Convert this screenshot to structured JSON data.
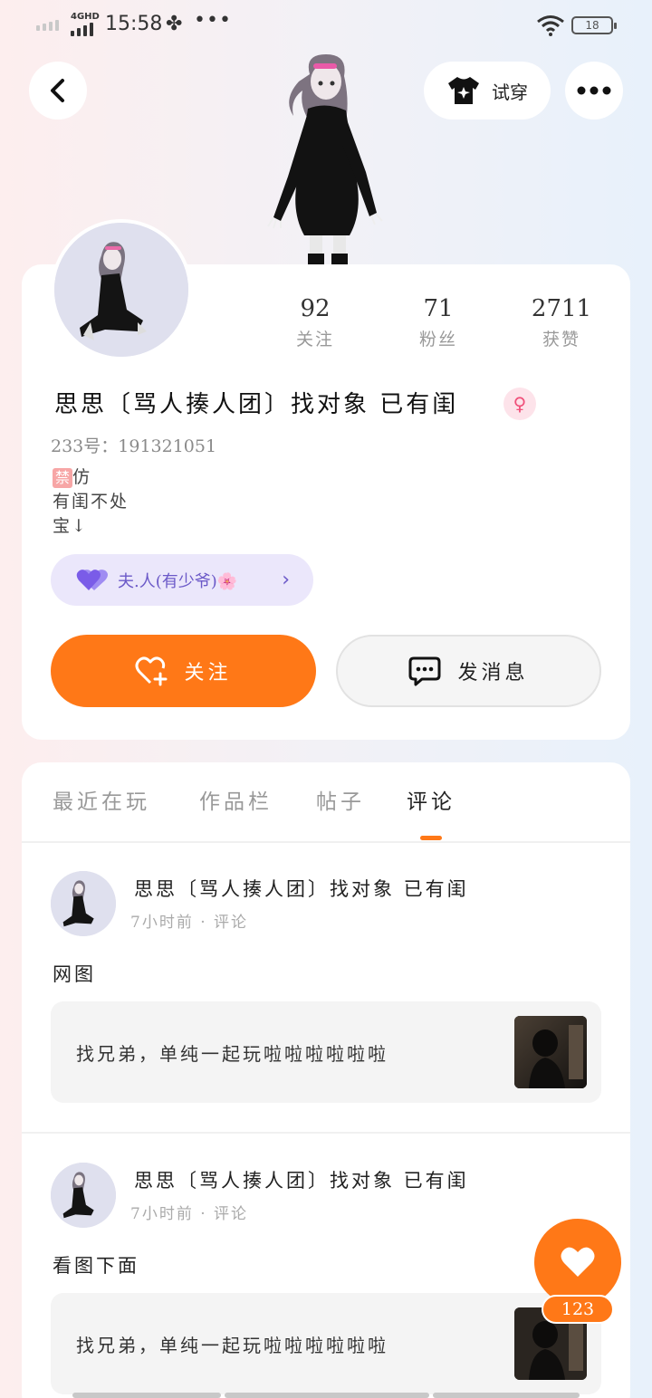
{
  "status_bar": {
    "network": "4GHD",
    "time": "15:58",
    "more": "•••",
    "battery": "18"
  },
  "top_bar": {
    "try_on_label": "试穿"
  },
  "profile": {
    "stats": [
      {
        "value": "92",
        "label": "关注"
      },
      {
        "value": "71",
        "label": "粉丝"
      },
      {
        "value": "2711",
        "label": "获赞"
      }
    ],
    "nickname": "思思〔骂人揍人团〕找对象 已有闺",
    "gender_symbol": "♀",
    "uid": "233号：191321051",
    "bio_badge": "禁",
    "bio_lines": [
      "仿",
      "有闺不处",
      "宝↓"
    ],
    "relation": {
      "label": "夫.人(有少爷)🌸",
      "heart_color": "#7a5ce8"
    },
    "follow_label": "关注",
    "message_label": "发消息"
  },
  "tabs": [
    {
      "label": "最近在玩",
      "active": false
    },
    {
      "label": "作品栏",
      "active": false
    },
    {
      "label": "帖子",
      "active": false
    },
    {
      "label": "评论",
      "active": true
    }
  ],
  "comments": [
    {
      "author": "思思〔骂人揍人团〕找对象 已有闺",
      "time": "7小时前",
      "type": "评论",
      "text": "网图",
      "quote": "找兄弟，单纯一起玩啦啦啦啦啦啦"
    },
    {
      "author": "思思〔骂人揍人团〕找对象 已有闺",
      "time": "7小时前",
      "type": "评论",
      "text": "看图下面",
      "quote": "找兄弟，单纯一起玩啦啦啦啦啦啦"
    }
  ],
  "fab": {
    "count": "123",
    "color": "#ff7817"
  },
  "colors": {
    "accent": "#ff7817",
    "relation_bg": "#ebe7fb",
    "gender_pink": "#f0507a"
  }
}
